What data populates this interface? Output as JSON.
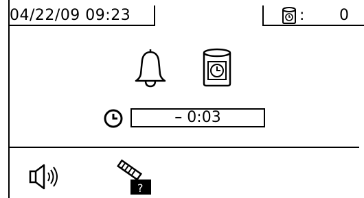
{
  "status_bar": {
    "datetime": "04/22/09 09:23",
    "counter_icon": "timer-can-icon",
    "counter_colon": ":",
    "counter_value": "0"
  },
  "main": {
    "alarm_icon": "bell-icon",
    "timer_icon": "timer-can-icon",
    "clock_icon": "clock-icon",
    "timer_value": "– 0:03"
  },
  "footer": {
    "left_icon": "speaker-icon",
    "right_icon": "maintenance-tool-icon"
  }
}
